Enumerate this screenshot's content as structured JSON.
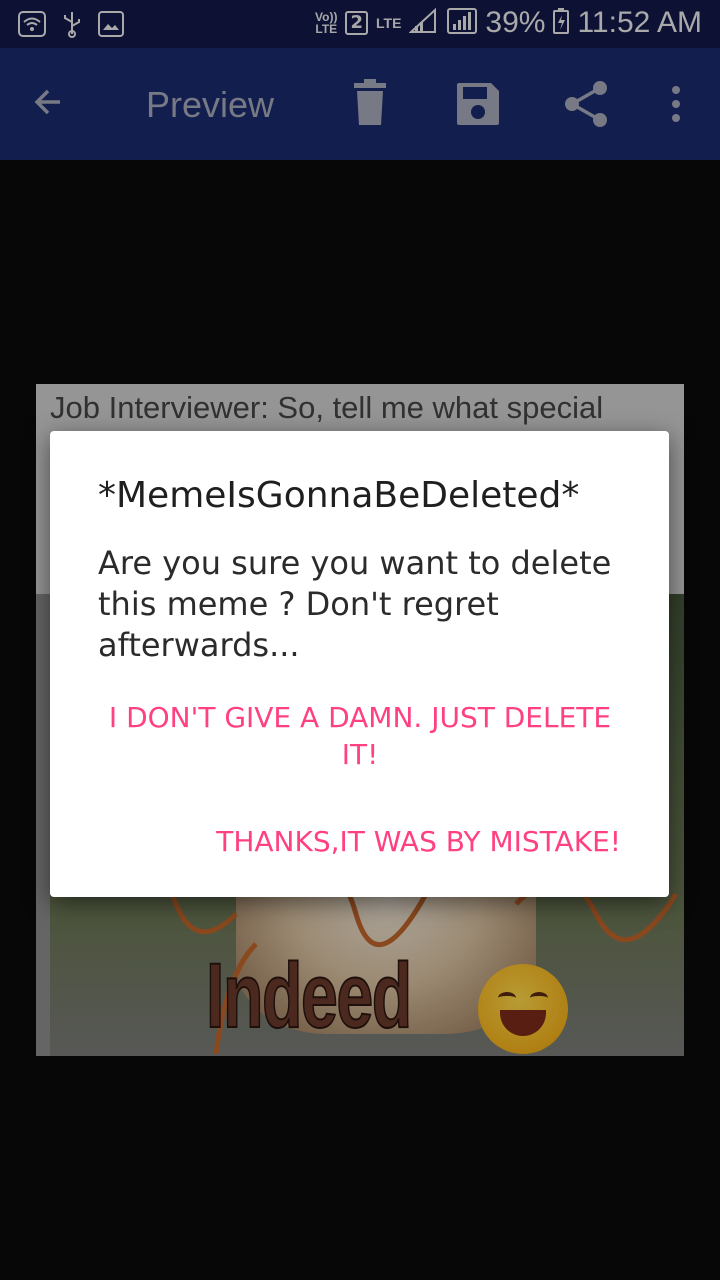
{
  "status_bar": {
    "volte": "Vo))",
    "lte_small": "LTE",
    "sim": "2",
    "lte": "LTE",
    "battery": "39%",
    "time": "11:52 AM",
    "left_icons": [
      "wifi-icon",
      "usb-icon",
      "image-icon"
    ]
  },
  "app_bar": {
    "title": "Preview",
    "back_icon": "arrow-left-icon",
    "actions": [
      "delete-icon",
      "save-icon",
      "share-icon",
      "more-vert-icon"
    ]
  },
  "meme": {
    "caption": "Job Interviewer: So, tell me what special",
    "bottom_text": "Indeed"
  },
  "dialog": {
    "title": "*MemeIsGonnaBeDeleted*",
    "message": "Are you sure you want to delete this meme ? Don't regret afterwards...",
    "confirm_label": "I DON'T GIVE A DAMN. JUST DELETE IT!",
    "cancel_label": "THANKS,IT WAS BY MISTAKE!",
    "accent_color": "#ff4081"
  },
  "colors": {
    "status_bar": "#121a4a",
    "app_bar": "#1a2a6c",
    "background": "#0a0a0a"
  }
}
